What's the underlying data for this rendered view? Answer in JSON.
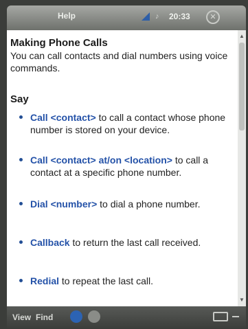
{
  "window": {
    "title": "Help",
    "time": "20:33",
    "close_icon": "close-icon"
  },
  "content": {
    "heading": "Making Phone Calls",
    "intro": "You can call contacts and dial numbers using voice commands.",
    "say_label": "Say",
    "items": [
      {
        "cmd": "Call <contact>",
        "desc": " to call a contact whose phone number is stored on your device."
      },
      {
        "cmd": "Call <contact> at/on <location>",
        "desc": " to call a contact at a specific phone number."
      },
      {
        "cmd": "Dial <number>",
        "desc": " to dial a phone number."
      },
      {
        "cmd": "Callback",
        "desc": " to return the last call received."
      },
      {
        "cmd": "Redial",
        "desc": " to repeat the last call."
      }
    ]
  },
  "toolbar": {
    "view_label": "View",
    "find_label": "Find"
  },
  "colors": {
    "accent": "#2452a8"
  }
}
